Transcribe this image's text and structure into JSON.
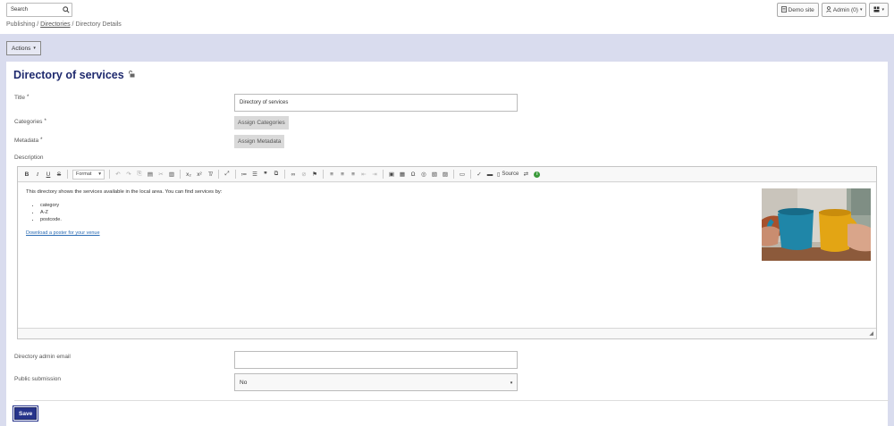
{
  "header": {
    "search_placeholder": "Search",
    "breadcrumb": {
      "root": "Publishing",
      "sep1": " / ",
      "link": "Directories",
      "sep2": " / ",
      "current": "Directory Details"
    },
    "demo_site_label": "Demo site",
    "admin_label": "Admin (0)",
    "icons": {
      "search": "search-icon",
      "demo": "document-icon",
      "user": "user-icon",
      "menu": "grid-icon"
    }
  },
  "actions_label": "Actions",
  "page": {
    "title": "Directory of services",
    "title_icon": "lock-icon"
  },
  "form": {
    "title_label": "Title",
    "title_required": "*",
    "title_value": "Directory of services",
    "categories_label": "Categories",
    "categories_required": "*",
    "categories_button": "Assign Categories",
    "metadata_label": "Metadata",
    "metadata_required": "*",
    "metadata_button": "Assign Metadata",
    "description_label": "Description",
    "admin_email_label": "Directory admin email",
    "admin_email_value": "",
    "public_submission_label": "Public submission",
    "public_submission_value": "No",
    "save_label": "Save"
  },
  "editor": {
    "format_label": "Format",
    "source_label": "Source",
    "intro": "This directory shows the services available in the local area. You can find services by:",
    "items": [
      "category",
      "A-Z",
      "postcode."
    ],
    "link_text": "Download a poster for your venue",
    "image_subject": "two cups toasting, blue and yellow"
  },
  "colors": {
    "band": "#d9dcee",
    "title": "#1f2a6e",
    "save": "#27348b",
    "link": "#2a6bb3"
  }
}
